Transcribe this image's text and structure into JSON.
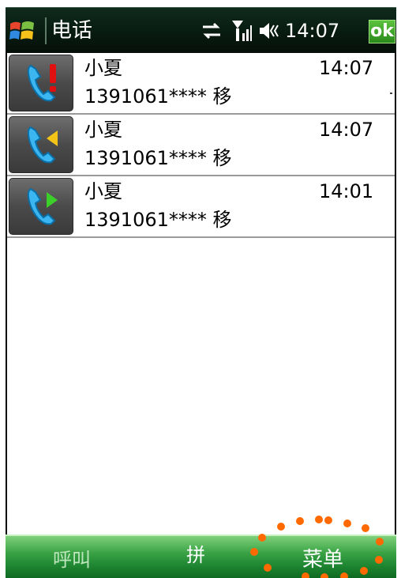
{
  "title_bar": {
    "app_title": "电话",
    "clock": "14:07",
    "ok_label": "ok",
    "icons": [
      "windows-start-icon",
      "sync-arrows-icon",
      "signal-strength-icon",
      "volume-muted-icon"
    ]
  },
  "call_log": [
    {
      "type": "missed",
      "icon": "missed-call-icon",
      "name": "小夏",
      "number": "1391061**** 移",
      "time": "14:07"
    },
    {
      "type": "incoming",
      "icon": "incoming-call-icon",
      "name": "小夏",
      "number": "1391061**** 移",
      "time": "14:07"
    },
    {
      "type": "outgoing",
      "icon": "outgoing-call-icon",
      "name": "小夏",
      "number": "1391061**** 移",
      "time": "14:01"
    }
  ],
  "soft_keys": {
    "left": "呼叫",
    "middle": "拼",
    "right": "菜单"
  },
  "colors": {
    "title_bar_bg": "#081a10",
    "soft_key_bar": "#2a9a3c",
    "ok_button": "#3ea02a",
    "highlight_dots": "#ff6a00"
  }
}
